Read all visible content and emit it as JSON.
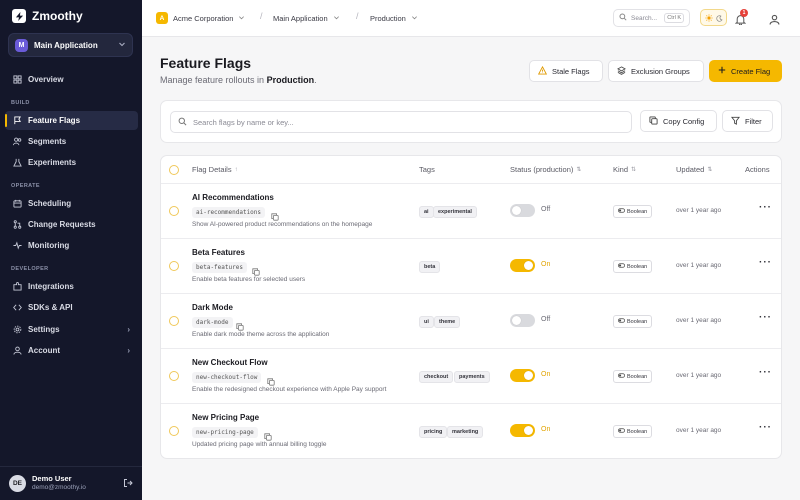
{
  "app": {
    "name": "Zmoothy"
  },
  "app_switcher": {
    "badge": "M",
    "label": "Main Application"
  },
  "sidebar": {
    "overview": "Overview",
    "build_label": "BUILD",
    "feature_flags": "Feature Flags",
    "segments": "Segments",
    "experiments": "Experiments",
    "operate_label": "OPERATE",
    "scheduling": "Scheduling",
    "change_requests": "Change Requests",
    "monitoring": "Monitoring",
    "developer_label": "DEVELOPER",
    "integrations": "Integrations",
    "sdks_api": "SDKs & API",
    "settings": "Settings",
    "account": "Account"
  },
  "user": {
    "initials": "DE",
    "name": "Demo User",
    "email": "demo@zmoothy.io"
  },
  "topbar": {
    "org_badge": "A",
    "org": "Acme Corporation",
    "app": "Main Application",
    "env": "Production",
    "search_placeholder": "Search...",
    "shortcut": "Ctrl K",
    "notifications": "1"
  },
  "page": {
    "title": "Feature Flags",
    "subtitle_prefix": "Manage feature rollouts in",
    "subtitle_env": "Production",
    "subtitle_suffix": "."
  },
  "actions": {
    "stale": "Stale Flags",
    "exclusion": "Exclusion Groups",
    "create": "Create Flag",
    "copy_config": "Copy Config",
    "filter": "Filter"
  },
  "search": {
    "placeholder": "Search flags by name or key..."
  },
  "table": {
    "headers": {
      "details": "Flag Details",
      "tags": "Tags",
      "status": "Status (production)",
      "kind": "Kind",
      "updated": "Updated",
      "actions": "Actions"
    },
    "rows": [
      {
        "name": "AI Recommendations",
        "key": "ai-recommendations",
        "desc": "Show AI-powered product recommendations on the homepage",
        "tags": [
          "ai",
          "experimental"
        ],
        "status": "Off",
        "kind": "Boolean",
        "updated": "over 1 year ago"
      },
      {
        "name": "Beta Features",
        "key": "beta-features",
        "desc": "Enable beta features for selected users",
        "tags": [
          "beta"
        ],
        "status": "On",
        "kind": "Boolean",
        "updated": "over 1 year ago"
      },
      {
        "name": "Dark Mode",
        "key": "dark-mode",
        "desc": "Enable dark mode theme across the application",
        "tags": [
          "ui",
          "theme"
        ],
        "status": "Off",
        "kind": "Boolean",
        "updated": "over 1 year ago"
      },
      {
        "name": "New Checkout Flow",
        "key": "new-checkout-flow",
        "desc": "Enable the redesigned checkout experience with Apple Pay support",
        "tags": [
          "checkout",
          "payments"
        ],
        "status": "On",
        "kind": "Boolean",
        "updated": "over 1 year ago"
      },
      {
        "name": "New Pricing Page",
        "key": "new-pricing-page",
        "desc": "Updated pricing page with annual billing toggle",
        "tags": [
          "pricing",
          "marketing"
        ],
        "status": "On",
        "kind": "Boolean",
        "updated": "over 1 year ago"
      }
    ]
  },
  "colors": {
    "accent": "#f5b800",
    "sidebar_bg": "#14172a",
    "page_bg": "#f6f6f7"
  }
}
